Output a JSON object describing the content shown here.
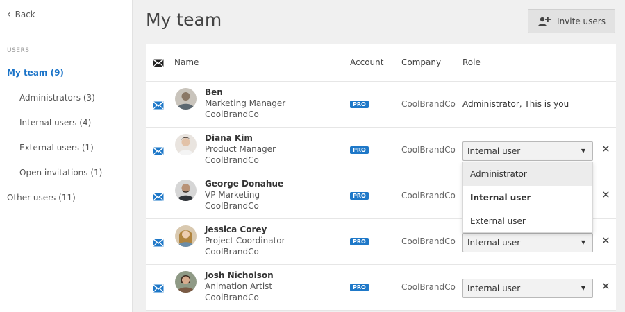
{
  "sidebar": {
    "back_label": "Back",
    "section_label": "USERS",
    "items": [
      {
        "label": "My team (9)"
      },
      {
        "label": "Administrators (3)"
      },
      {
        "label": "Internal users (4)"
      },
      {
        "label": "External users (1)"
      },
      {
        "label": "Open invitations (1)"
      },
      {
        "label": "Other users (11)"
      }
    ]
  },
  "header": {
    "title": "My team",
    "invite_label": "Invite users"
  },
  "table": {
    "columns": {
      "name": "Name",
      "account": "Account",
      "company": "Company",
      "role": "Role"
    },
    "rows": [
      {
        "name": "Ben",
        "title": "Marketing Manager",
        "org": "CoolBrandCo",
        "account": "PRO",
        "company": "CoolBrandCo",
        "role": "Administrator, This is you"
      },
      {
        "name": "Diana Kim",
        "title": "Product Manager",
        "org": "CoolBrandCo",
        "account": "PRO",
        "company": "CoolBrandCo",
        "role": "Internal user"
      },
      {
        "name": "George Donahue",
        "title": "VP Marketing",
        "org": "CoolBrandCo",
        "account": "PRO",
        "company": "CoolBrandCo",
        "role": ""
      },
      {
        "name": "Jessica Corey",
        "title": "Project Coordinator",
        "org": "CoolBrandCo",
        "account": "PRO",
        "company": "CoolBrandCo",
        "role": "Internal user"
      },
      {
        "name": "Josh Nicholson",
        "title": "Animation Artist",
        "org": "CoolBrandCo",
        "account": "PRO",
        "company": "CoolBrandCo",
        "role": "Internal user"
      }
    ]
  },
  "role_dropdown": {
    "options": [
      "Administrator",
      "Internal user",
      "External user"
    ],
    "selected": "Internal user",
    "hovered": "Administrator"
  },
  "colors": {
    "accent": "#1a73c8",
    "pro_badge": "#1e78c8"
  }
}
